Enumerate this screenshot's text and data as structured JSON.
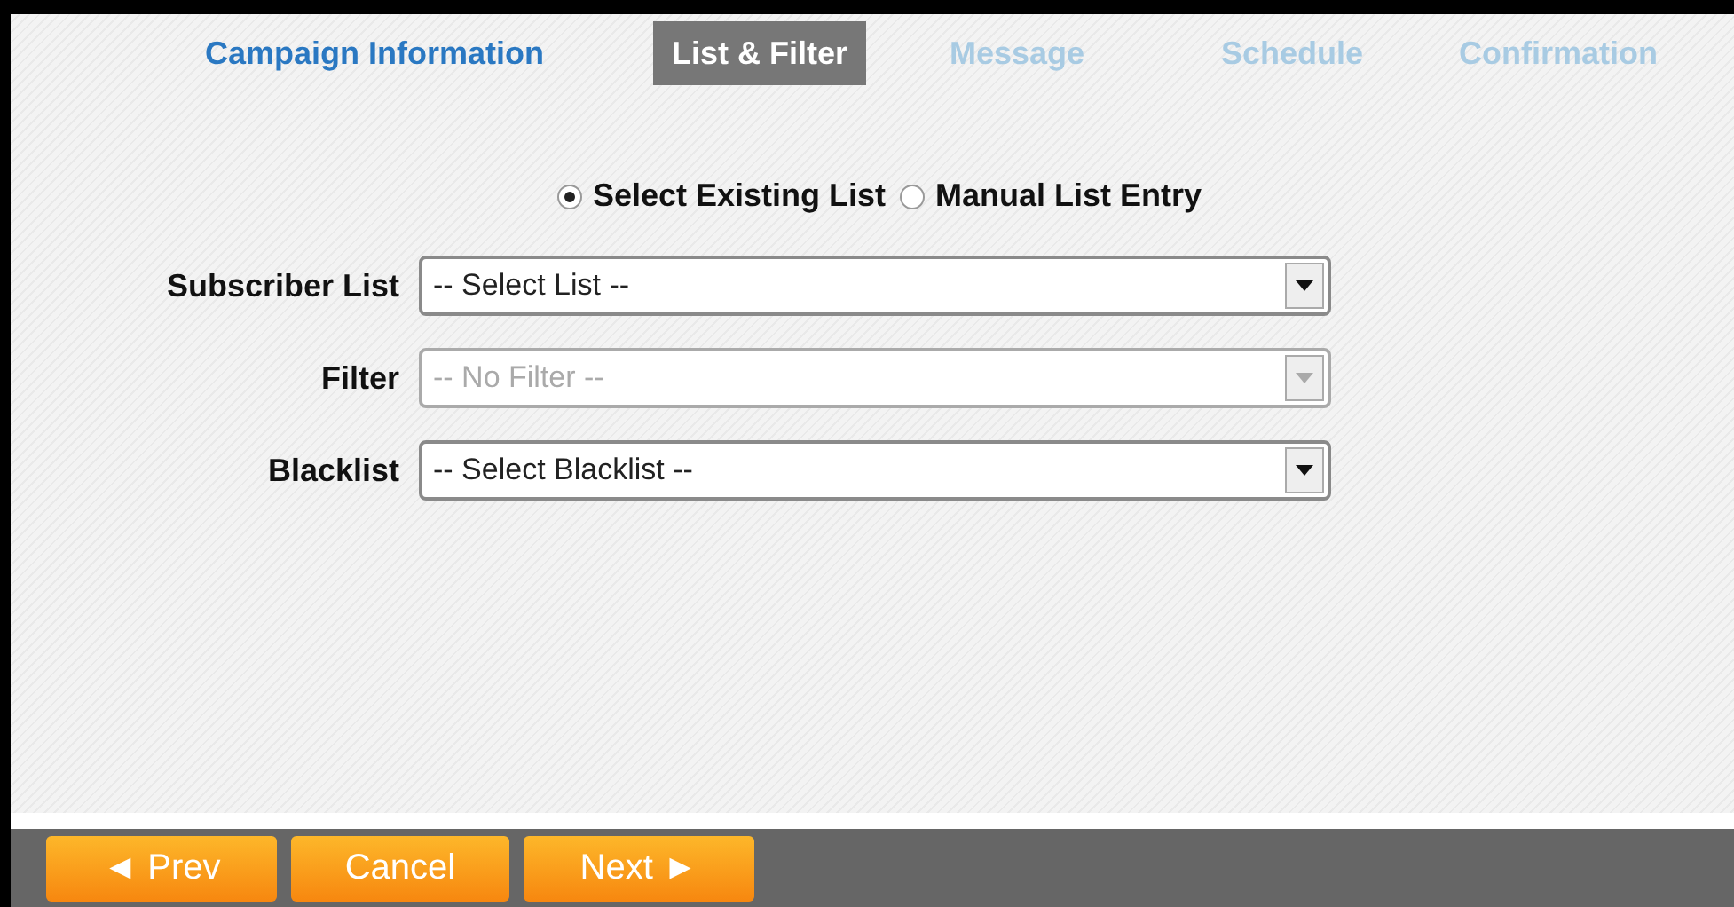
{
  "tabs": [
    {
      "label": "Campaign Information",
      "selected": false,
      "disabled": false
    },
    {
      "label": "List & Filter",
      "selected": true,
      "disabled": false
    },
    {
      "label": "Message",
      "selected": false,
      "disabled": true
    },
    {
      "label": "Schedule",
      "selected": false,
      "disabled": true
    },
    {
      "label": "Confirmation",
      "selected": false,
      "disabled": true
    }
  ],
  "list_source": [
    {
      "label": "Select Existing List",
      "selected": true
    },
    {
      "label": "Manual List Entry",
      "selected": false
    }
  ],
  "fields": [
    {
      "label": "Subscriber List",
      "value": "-- Select List --",
      "disabled": false
    },
    {
      "label": "Filter",
      "value": "-- No Filter --",
      "disabled": true
    },
    {
      "label": "Blacklist",
      "value": "-- Select Blacklist --",
      "disabled": false
    }
  ],
  "buttons": [
    "◄ Prev",
    "Cancel",
    "Next ►"
  ]
}
